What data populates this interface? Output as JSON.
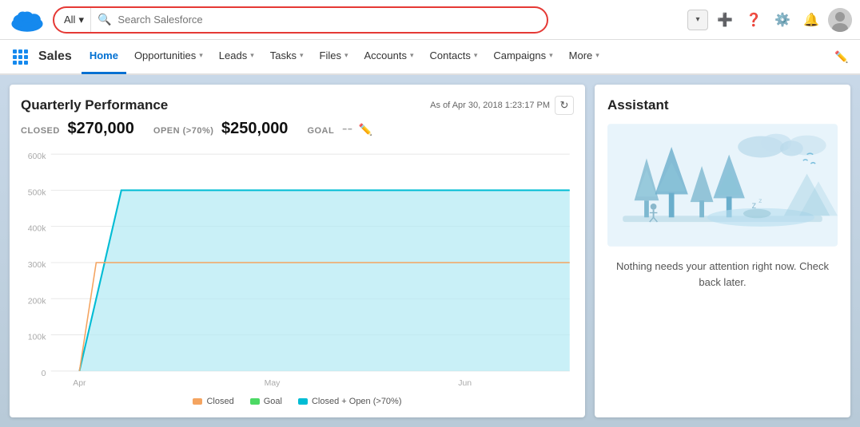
{
  "topbar": {
    "search_all_label": "All",
    "search_placeholder": "Search Salesforce",
    "dropdown_arrow": "▾"
  },
  "navbar": {
    "brand": "Sales",
    "items": [
      {
        "label": "Home",
        "active": true,
        "has_dropdown": false
      },
      {
        "label": "Opportunities",
        "active": false,
        "has_dropdown": true
      },
      {
        "label": "Leads",
        "active": false,
        "has_dropdown": true
      },
      {
        "label": "Tasks",
        "active": false,
        "has_dropdown": true
      },
      {
        "label": "Files",
        "active": false,
        "has_dropdown": true
      },
      {
        "label": "Accounts",
        "active": false,
        "has_dropdown": true
      },
      {
        "label": "Contacts",
        "active": false,
        "has_dropdown": true
      },
      {
        "label": "Campaigns",
        "active": false,
        "has_dropdown": true
      },
      {
        "label": "More",
        "active": false,
        "has_dropdown": true
      }
    ]
  },
  "chart": {
    "title": "Quarterly Performance",
    "date_label": "As of Apr 30, 2018 1:23:17 PM",
    "closed_label": "CLOSED",
    "closed_value": "$270,000",
    "open_label": "OPEN (>70%)",
    "open_value": "$250,000",
    "goal_label": "GOAL",
    "goal_value": "--",
    "x_labels": [
      "Apr",
      "May",
      "Jun"
    ],
    "y_labels": [
      "600k",
      "500k",
      "400k",
      "300k",
      "200k",
      "100k",
      "0"
    ],
    "legend": [
      {
        "label": "Closed",
        "color": "#f4a460"
      },
      {
        "label": "Goal",
        "color": "#4cd964"
      },
      {
        "label": "Closed + Open (>70%)",
        "color": "#00bcd4"
      }
    ]
  },
  "assistant": {
    "title": "Assistant",
    "message": "Nothing needs your attention right now. Check back later."
  }
}
